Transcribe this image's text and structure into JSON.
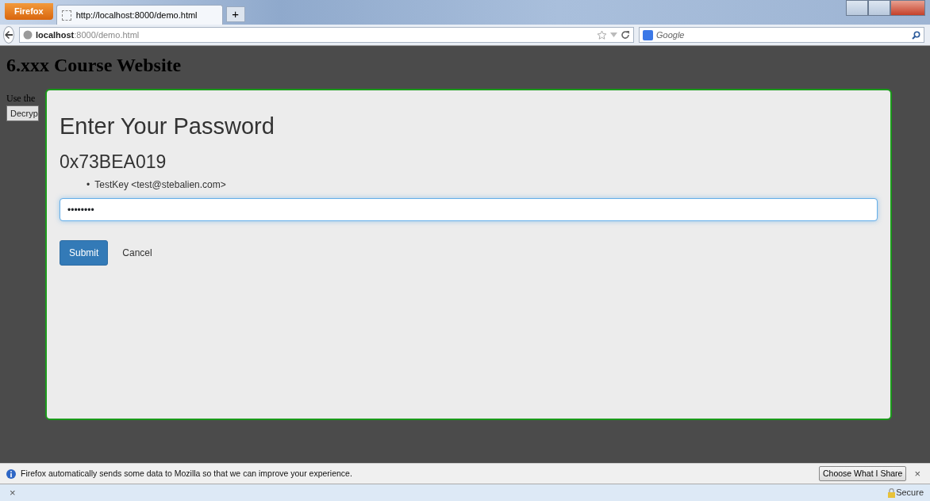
{
  "browser": {
    "menu_button": "Firefox",
    "tabs": [
      {
        "title": "http://localhost:8000/demo.html",
        "selected": true
      }
    ],
    "new_tab": "+",
    "address": {
      "host": "localhost",
      "path": ":8000/demo.html"
    },
    "search": {
      "placeholder": "Google"
    }
  },
  "page": {
    "heading": "6.xxx Course Website",
    "intro": "Use the",
    "button": "Decryp"
  },
  "modal": {
    "title": "Enter Your Password",
    "key_id": "0x73BEA019",
    "user_ids": [
      {
        "marker": "•",
        "text": "TestKey <test@stebalien.com>"
      }
    ],
    "password": "••••••••",
    "buttons": [
      {
        "label": "Submit",
        "kind": "primary"
      },
      {
        "label": "Cancel",
        "kind": "plain"
      }
    ]
  },
  "notification": {
    "text": "Firefox automatically sends some data to Mozilla so that we can improve your experience.",
    "button": "Choose What I Share",
    "close": "×"
  },
  "status_bar": {
    "close": "×",
    "security": "Secure"
  }
}
